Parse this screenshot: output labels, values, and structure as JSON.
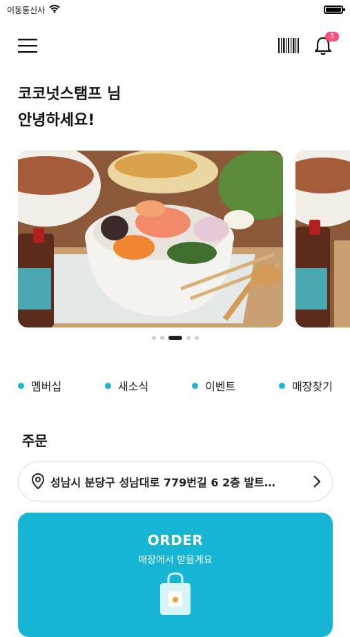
{
  "status_bar": {
    "carrier": "이동통신사"
  },
  "header": {
    "notification_count": "5"
  },
  "greeting": {
    "line1": "코코넛스탬프 님",
    "line2": "안녕하세요!"
  },
  "carousel": {
    "slide_count": 5,
    "active_index": 2
  },
  "quick_menu": [
    {
      "label": "멤버십"
    },
    {
      "label": "새소식"
    },
    {
      "label": "이벤트"
    },
    {
      "label": "매장찾기"
    }
  ],
  "order_section": {
    "title": "주문",
    "address": "성남시 분당구 성남대로 779번길 6 2층 발트…",
    "card_title": "ORDER",
    "card_subtitle": "매장에서 받을게요"
  },
  "colors": {
    "accent": "#15b5d3",
    "badge": "#ff4d7a"
  }
}
